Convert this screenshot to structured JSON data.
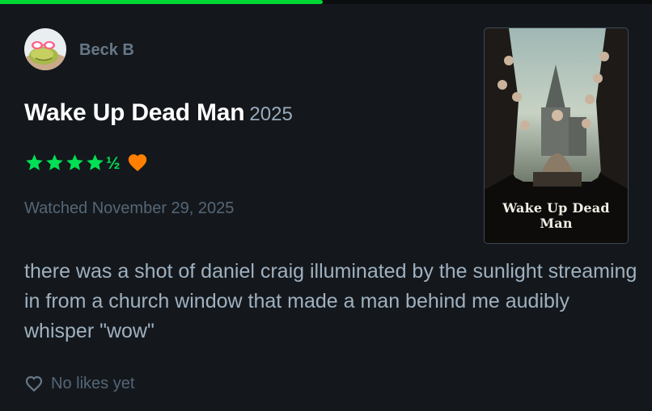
{
  "progress": {
    "fraction": 0.495,
    "color": "#00d735"
  },
  "user": {
    "name": "Beck B",
    "avatar_icon": "frog-avatar"
  },
  "film": {
    "title": "Wake Up Dead Man",
    "year": "2025"
  },
  "rating": {
    "stars": 4.5,
    "half_glyph": "½",
    "liked": true,
    "star_color": "#00e054",
    "heart_color": "#ff8000"
  },
  "watched": "Watched November 29, 2025",
  "review": "there was a shot of daniel craig illuminated by the sunlight streaming in from a church window that made a man behind me audibly whisper \"wow\"",
  "likes": {
    "label": "No likes yet",
    "icon": "heart-outline-icon"
  },
  "poster": {
    "caption": "Wake Up Dead Man"
  }
}
